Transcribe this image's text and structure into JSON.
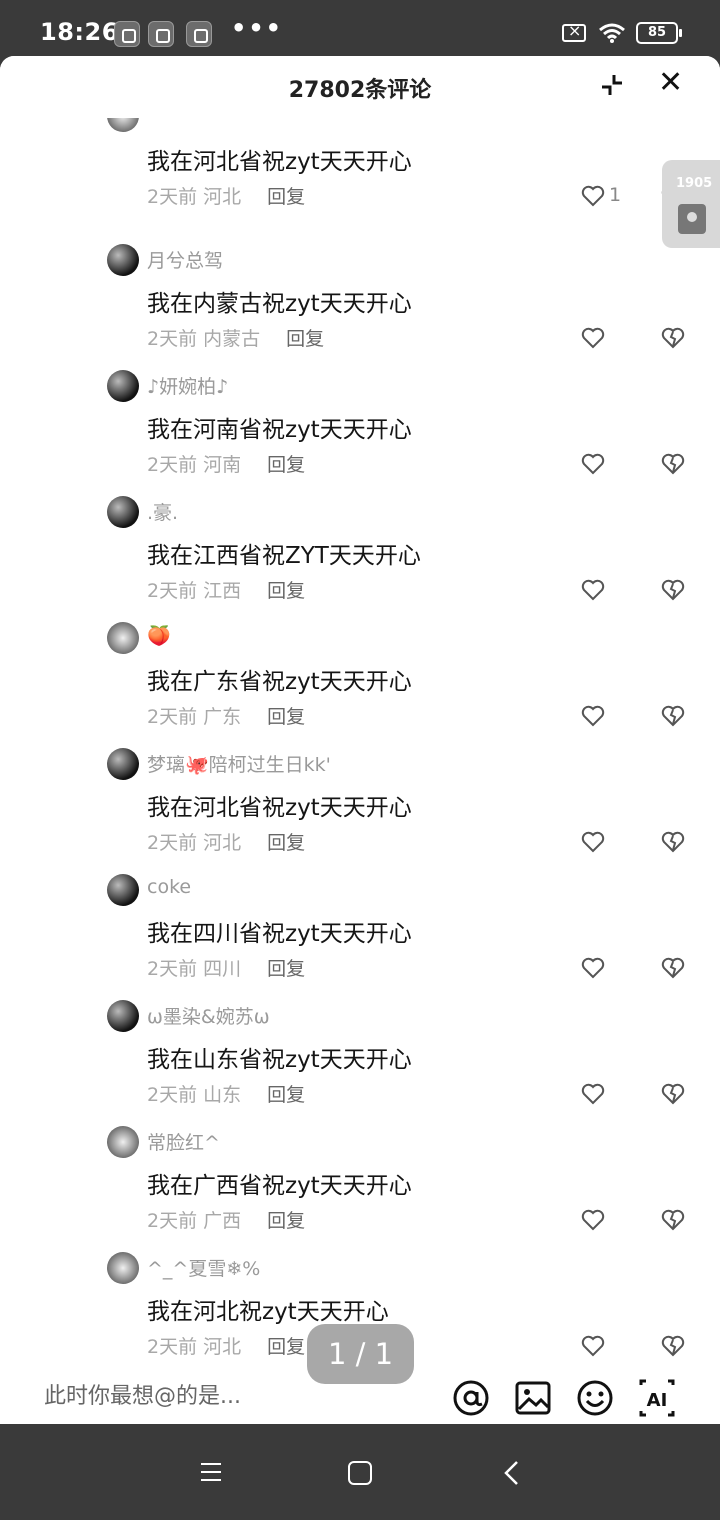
{
  "status_bar": {
    "time": "18:26",
    "battery": "85"
  },
  "header": {
    "title": "27802条评论"
  },
  "side_widget": {
    "count": "1905"
  },
  "comments": [
    {
      "username": "",
      "content": "我在河北省祝zyt天天开心",
      "time": "2天前",
      "location": "河北",
      "reply": "回复",
      "likes": "1"
    },
    {
      "username": "月兮总驾",
      "content": "我在内蒙古祝zyt天天开心",
      "time": "2天前",
      "location": "内蒙古",
      "reply": "回复",
      "likes": ""
    },
    {
      "username": "♪妍婉柏♪",
      "content": "我在河南省祝zyt天天开心",
      "time": "2天前",
      "location": "河南",
      "reply": "回复",
      "likes": ""
    },
    {
      "username": ".豪.",
      "content": "我在江西省祝ZYT天天开心",
      "time": "2天前",
      "location": "江西",
      "reply": "回复",
      "likes": ""
    },
    {
      "username": "🍑",
      "content": "我在广东省祝zyt天天开心",
      "time": "2天前",
      "location": "广东",
      "reply": "回复",
      "likes": ""
    },
    {
      "username": "梦璃🐙陪柯过生日kk'",
      "content": "我在河北省祝zyt天天开心",
      "time": "2天前",
      "location": "河北",
      "reply": "回复",
      "likes": ""
    },
    {
      "username": "coke",
      "content": "我在四川省祝zyt天天开心",
      "time": "2天前",
      "location": "四川",
      "reply": "回复",
      "likes": ""
    },
    {
      "username": "ω墨染&婉苏ω",
      "content": "我在山东省祝zyt天天开心",
      "time": "2天前",
      "location": "山东",
      "reply": "回复",
      "likes": ""
    },
    {
      "username": "常脸红^",
      "content": "我在广西省祝zyt天天开心",
      "time": "2天前",
      "location": "广西",
      "reply": "回复",
      "likes": ""
    },
    {
      "username": "^_^夏雪❄%",
      "content": "我在河北祝zyt天天开心",
      "time": "2天前",
      "location": "河北",
      "reply": "回复",
      "likes": ""
    }
  ],
  "page_indicator": "1 / 1",
  "input": {
    "placeholder": "此时你最想@的是..."
  },
  "icons": {
    "like": "heart-outline-icon",
    "dislike": "broken-heart-icon",
    "mention": "at-icon",
    "image": "image-icon",
    "emoji": "emoji-icon",
    "ai": "ai-icon"
  }
}
